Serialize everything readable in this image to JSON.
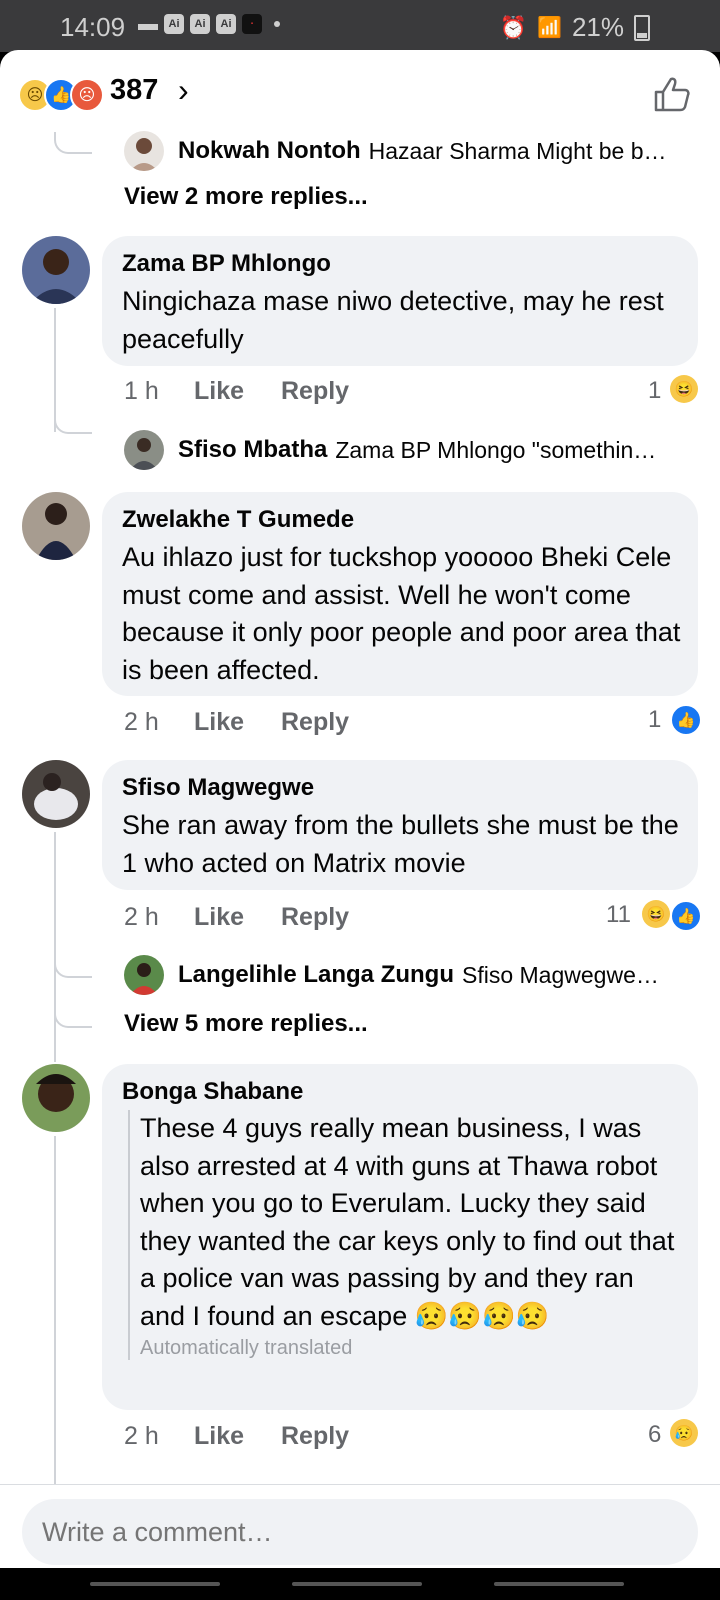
{
  "status_bar": {
    "time": "14:09",
    "notif_chips": [
      "Ai",
      "Ai",
      "Ai"
    ],
    "battery_pct": "21%"
  },
  "reactions": {
    "count": "387",
    "emoji_names": [
      "sad-emoji",
      "like-emoji",
      "angry-emoji"
    ]
  },
  "comments": {
    "c0_reply": {
      "name": "Nokwah Nontoh",
      "text": "Hazaar Sharma Might be b…"
    },
    "c0_more": "View 2 more replies...",
    "c1": {
      "name": "Zama BP Mhlongo",
      "text": "Ningichaza mase niwo detective, may he rest peacefully",
      "time": "1 h",
      "like": "Like",
      "reply": "Reply",
      "reactions": "1",
      "reply_preview": {
        "name": "Sfiso Mbatha",
        "text": "Zama BP Mhlongo \"somethin…"
      }
    },
    "c2": {
      "name": "Zwelakhe T Gumede",
      "text": "Au ihlazo just for tuckshop yooooo Bheki Cele must come and assist. Well he won't come because it only poor people and poor area that is been affected.",
      "time": "2 h",
      "like": "Like",
      "reply": "Reply",
      "reactions": "1"
    },
    "c3": {
      "name": "Sfiso Magwegwe",
      "text": "She ran away from the bullets she must be the 1 who acted on Matrix movie",
      "time": "2 h",
      "like": "Like",
      "reply": "Reply",
      "reactions": "11",
      "reply_preview": {
        "name": "Langelihle Langa Zungu",
        "text": "Sfiso Magwegwe…"
      },
      "more": "View 5 more replies..."
    },
    "c4": {
      "name": "Bonga Shabane",
      "text": "These 4 guys really mean business, I was also arrested at 4 with guns at Thawa robot when you go to Everulam. Lucky they said they wanted the car keys only to find out that a police van was passing by and they ran and I found an escape 😥😥😥😥",
      "translated": "Automatically translated",
      "time": "2 h",
      "like": "Like",
      "reply": "Reply",
      "reactions": "6"
    }
  },
  "composer": {
    "placeholder": "Write a comment…"
  },
  "colors": {
    "like_blue": "#1877f2",
    "bubble_bg": "#f0f2f5",
    "meta_gray": "#65676b"
  }
}
